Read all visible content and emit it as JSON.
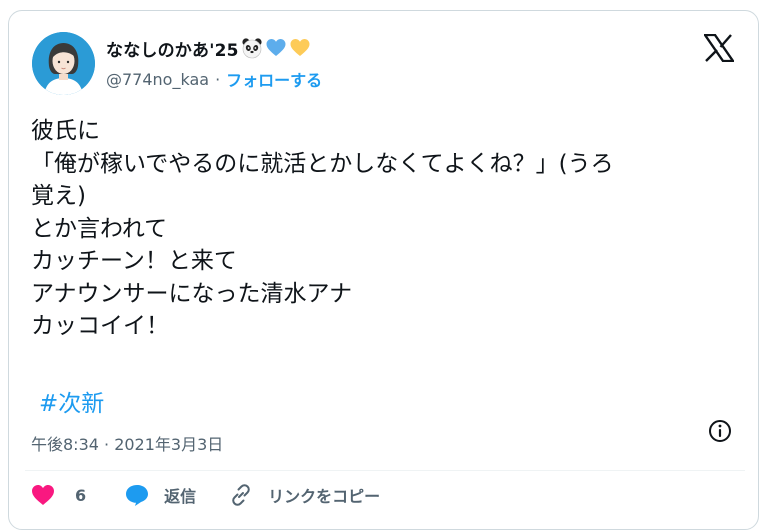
{
  "author": {
    "display_name": "ななしのかあ'25",
    "emoji": [
      "panda-face",
      "blue-heart",
      "yellow-heart"
    ],
    "handle": "@774no_kaa",
    "separator": "·",
    "follow_label": "フォローする"
  },
  "tweet": {
    "lines": [
      "彼氏に",
      "「俺が稼いでやるのに就活とかしなくてよくね？」(うろ",
      "覚え)",
      "とか言われて",
      "カッチーン！と来て",
      "アナウンサーになった清水アナ",
      "カッコイイ！"
    ],
    "hashtag": "#次新",
    "timestamp": "午後8:34 · 2021年3月3日"
  },
  "actions": {
    "like_count": "6",
    "reply_label": "返信",
    "copy_link_label": "リンクをコピー"
  },
  "colors": {
    "accent": "#1d9bf0",
    "like": "#f91880",
    "text": "#0f1419",
    "muted": "#536471",
    "border": "#cfd9de"
  },
  "icons": [
    "x-logo-icon",
    "info-icon",
    "heart-icon",
    "reply-bubble-icon",
    "link-icon"
  ]
}
